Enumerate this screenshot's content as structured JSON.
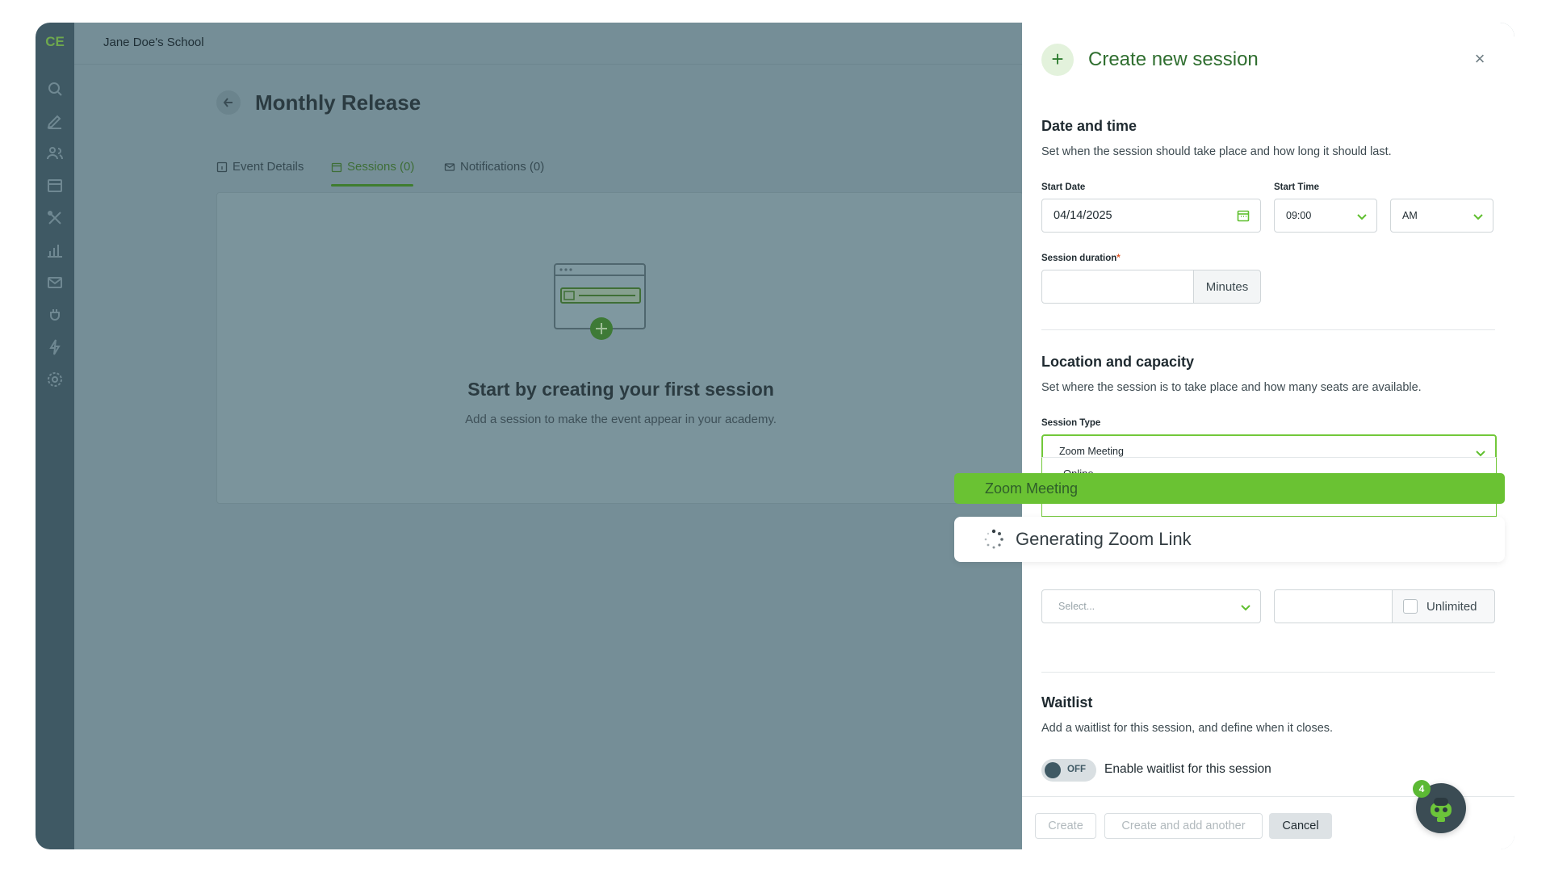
{
  "sidebar": {
    "logo": "CE",
    "icons": [
      "search-icon",
      "pencil-icon",
      "users-icon",
      "store-icon",
      "tools-icon",
      "chart-icon",
      "mail-icon",
      "plug-icon",
      "lightning-icon",
      "gear-icon"
    ]
  },
  "topbar": {
    "school_name": "Jane Doe's School"
  },
  "page": {
    "title": "Monthly Release",
    "tabs": [
      {
        "label": "Event Details",
        "icon": "info-icon"
      },
      {
        "label": "Sessions (0)",
        "icon": "calendar-icon",
        "active": true
      },
      {
        "label": "Notifications (0)",
        "icon": "mail-icon"
      }
    ],
    "empty_state": {
      "title": "Start by creating your first session",
      "subtitle": "Add a session to make the event appear in your academy."
    }
  },
  "panel": {
    "title": "Create new session",
    "date_time": {
      "title": "Date and time",
      "description": "Set when the session should take place and how long it should last.",
      "start_date_label": "Start Date",
      "start_date_value": "04/14/2025",
      "start_time_label": "Start Time",
      "start_time_value": "09:00",
      "ampm_value": "AM",
      "duration_label": "Session duration",
      "duration_required": "*",
      "duration_value": "",
      "duration_unit": "Minutes"
    },
    "location": {
      "title": "Location and capacity",
      "description": "Set where the session is to take place and how many seats are available.",
      "session_type_label": "Session Type",
      "session_type_value": "Zoom Meeting",
      "dropdown_options": [
        "Online",
        "Zoom Meeting"
      ],
      "select_placeholder": "Select...",
      "capacity_value": "",
      "unlimited_label": "Unlimited",
      "unlimited_checked": false
    },
    "overlay": {
      "highlight_option": "Zoom Meeting",
      "status_text": "Generating Zoom Link"
    },
    "waitlist": {
      "title": "Waitlist",
      "description": "Add a waitlist for this session, and define when it closes.",
      "toggle_state": "OFF",
      "toggle_label": "Enable waitlist for this session"
    },
    "footer": {
      "create_label": "Create",
      "create_another_label": "Create and add another",
      "cancel_label": "Cancel"
    }
  },
  "helper": {
    "badge_count": "4"
  },
  "colors": {
    "accent": "#2f7d32",
    "highlight": "#6ac233",
    "sidebar": "#3f5964",
    "overlay": "#758e97"
  }
}
